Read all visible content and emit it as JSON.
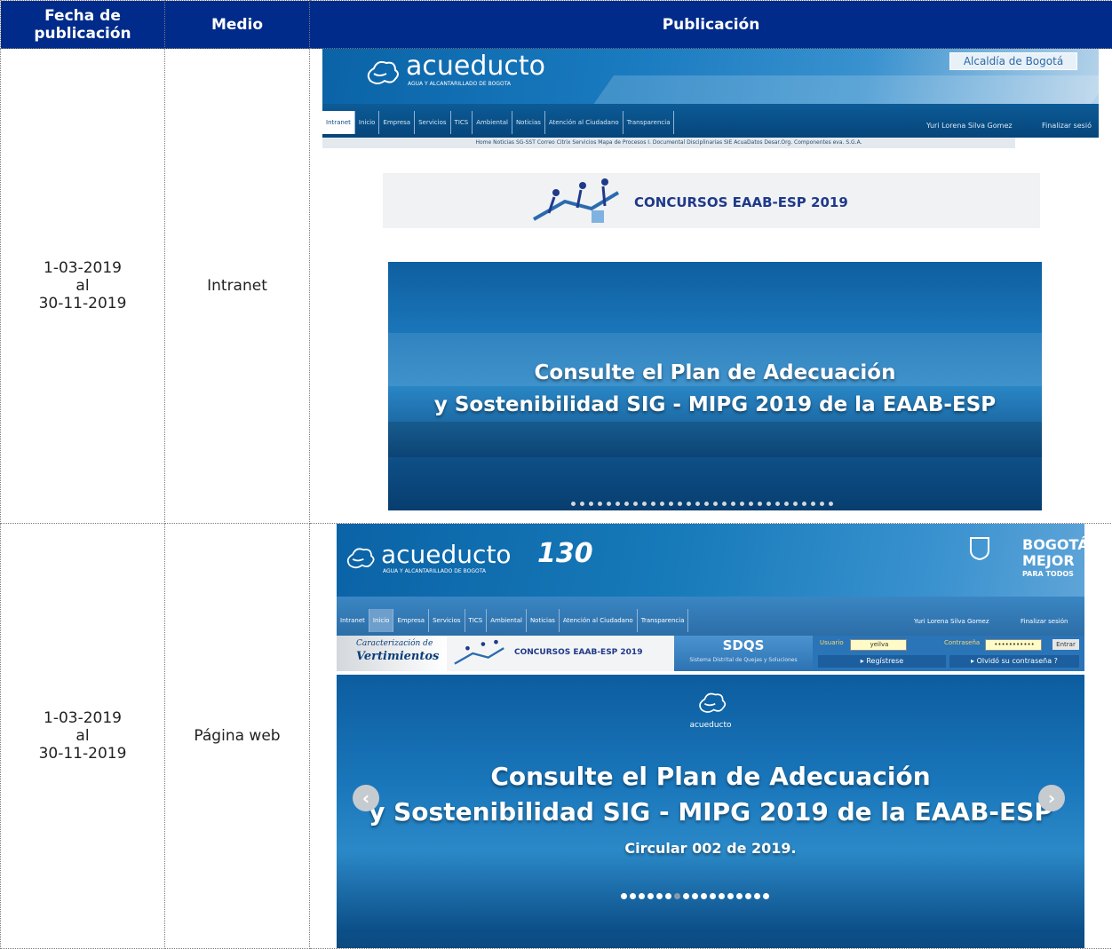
{
  "table": {
    "headers": {
      "fecha": "Fecha de publicación",
      "medio": "Medio",
      "publicacion": "Publicación"
    },
    "rows": [
      {
        "fecha_from": "1-03-2019",
        "fecha_sep": "al",
        "fecha_to": "30-11-2019",
        "medio": "Intranet"
      },
      {
        "fecha_from": "1-03-2019",
        "fecha_sep": "al",
        "fecha_to": "30-11-2019",
        "medio": "Página web"
      }
    ]
  },
  "intranet_shot": {
    "logo": "acueducto",
    "logo_sub": "AGUA Y ALCANTARILLADO DE BOGOTA",
    "alcaldia": "Alcaldía de Bogotá",
    "nav": [
      "Intranet",
      "Inicio",
      "Empresa",
      "Servicios",
      "TICS",
      "Ambiental",
      "Noticias",
      "Atención al Ciudadano",
      "Transparencia"
    ],
    "user": "Yuri Lorena Silva Gomez",
    "logout": "Finalizar sesió",
    "subnav": "Home  Noticias  SG-SST  Correo  Citrix  Servicios  Mapa de Procesos  I. Documental  Disciplinarias  SIE  AcuaDatos  Desar.Org.  Componentes eva.  S.G.A.",
    "banner_title": "CONCURSOS EAAB-ESP 2019",
    "hero_line1": "Consulte el Plan de Adecuación",
    "hero_line2": "y Sostenibilidad SIG - MIPG 2019 de la EAAB-ESP"
  },
  "web_shot": {
    "logo": "acueducto",
    "logo_sub": "AGUA Y ALCANTARILLADO DE BOGOTA",
    "anniv": "130",
    "bogota1": "BOGOTÁ",
    "bogota2": "MEJOR",
    "bogota3": "PARA TODOS",
    "nav": [
      "Intranet",
      "Inicio",
      "Empresa",
      "Servicios",
      "TICS",
      "Ambiental",
      "Noticias",
      "Atención al Ciudadano",
      "Transparencia"
    ],
    "user": "Yuri Lorena Silva Gomez",
    "logout": "Finalizar sesión",
    "vert1": "Caracterización de",
    "vert2": "Vertimientos",
    "banner_title": "CONCURSOS EAAB-ESP 2019",
    "sdqs": "SDQS",
    "sdqs_sub": "Sistema Distrital de Quejas y Soluciones",
    "usuario_label": "Usuario",
    "usuario_value": "yeilva",
    "contrasena_label": "Contraseña",
    "contrasena_value": "•••••••••••",
    "entrar": "Entrar",
    "registrese": "Regístrese",
    "olvido": "Olvidó su contraseña ?",
    "hero_logo": "acueducto",
    "hero_line1": "Consulte el Plan de Adecuación",
    "hero_line2": "y Sostenibilidad SIG - MIPG 2019 de la EAAB-ESP",
    "hero_line3": "Circular 002 de 2019."
  },
  "colors": {
    "header_bg": "#002b8a",
    "header_text": "#ffffff",
    "accent_blue": "#1b77ba"
  }
}
